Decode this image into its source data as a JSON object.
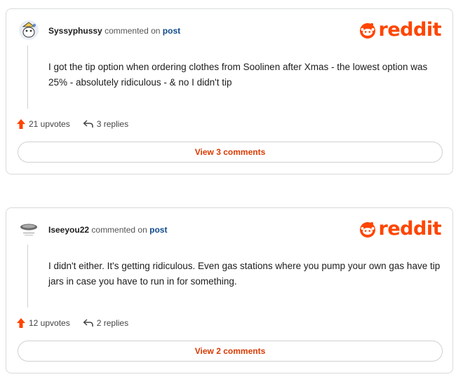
{
  "comments": [
    {
      "username": "Syssyphussy",
      "action": "commented on",
      "post_link": "post",
      "brand": "reddit",
      "text": "I got the tip option when ordering clothes from Soolinen after Xmas - the lowest option was 25% - absolutely ridiculous - & no I didn't tip",
      "upvotes": "21 upvotes",
      "replies": "3 replies",
      "view_comments": "View 3 comments"
    },
    {
      "username": "Iseeyou22",
      "action": "commented on",
      "post_link": "post",
      "brand": "reddit",
      "text": "I didn't either. It's getting ridiculous. Even gas stations where you pump your own gas have tip jars in case you have to run in for something.",
      "upvotes": "12 upvotes",
      "replies": "2 replies",
      "view_comments": "View 2 comments"
    }
  ],
  "colors": {
    "brand": "#ff4500",
    "link": "#0f4a8a",
    "button_text": "#d93a00"
  }
}
